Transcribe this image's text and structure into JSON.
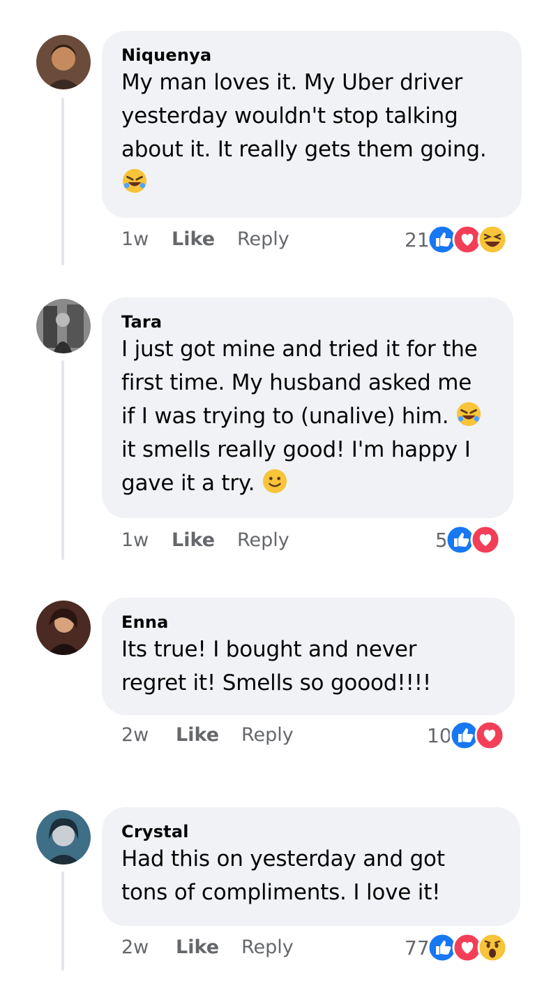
{
  "comments": [
    {
      "author": "Niquenya",
      "lines": [
        "My man loves it. My Uber driver",
        "yesterday wouldn't stop talking",
        "about it. It really gets them going."
      ],
      "time": "1w",
      "like": "Like",
      "reply": "Reply",
      "reaction_count": "21",
      "reactions": [
        "like-icon",
        "love-icon",
        "haha-icon"
      ]
    },
    {
      "author": "Tara",
      "lines": [
        "I just got mine and tried it for the",
        "first time. My husband asked me",
        "if I was trying to (unalive) him.",
        "it smells really good! I'm happy I",
        "gave it a try."
      ],
      "time": "1w",
      "like": "Like",
      "reply": "Reply",
      "reaction_count": "5",
      "reactions": [
        "like-icon",
        "love-icon"
      ]
    },
    {
      "author": "Enna",
      "lines": [
        "Its true! I bought and never",
        "regret it! Smells so goood!!!!"
      ],
      "time": "2w",
      "like": "Like",
      "reply": "Reply",
      "reaction_count": "10",
      "reactions": [
        "like-icon",
        "love-icon"
      ]
    },
    {
      "author": "Crystal",
      "lines": [
        "Had this on yesterday and got",
        "tons of compliments. I love it!"
      ],
      "time": "2w",
      "like": "Like",
      "reply": "Reply",
      "reaction_count": "77",
      "reactions": [
        "like-icon",
        "love-icon",
        "wow-icon"
      ]
    }
  ],
  "colors": {
    "bubble": "#f0f2f5",
    "like_blue": "#1877f2",
    "love_red": "#f33e58",
    "meta_gray": "#65676b"
  }
}
